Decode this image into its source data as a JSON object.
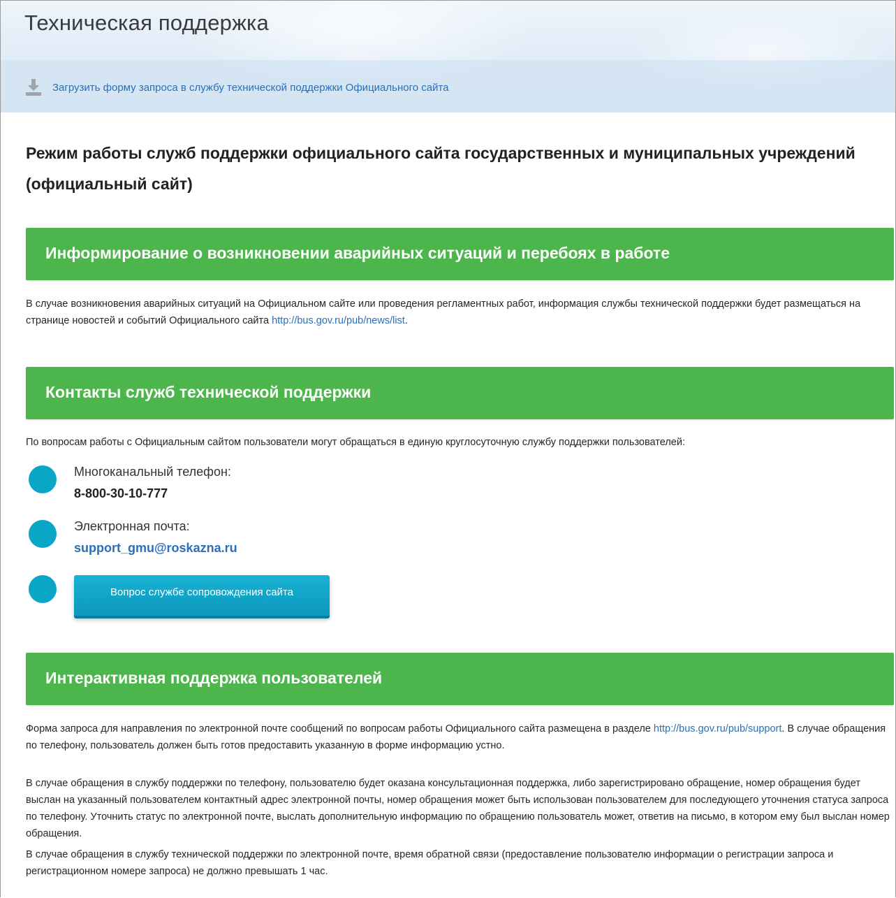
{
  "header": {
    "title": "Техническая поддержка",
    "download_icon": "download-icon",
    "download_link": "Загрузить форму запроса в службу технической поддержки Официального сайта"
  },
  "main_heading": "Режим работы служб поддержки официального сайта государственных и муниципальных учреждений (официальный сайт)",
  "sections": {
    "incidents": {
      "title": "Информирование о возникновении аварийных ситуаций и перебоях в работе",
      "text": "В случае возникновения аварийных ситуаций на Официальном сайте или проведения регламентных работ, информация службы технической поддержки будет размещаться на странице новостей и событий Официального сайта ",
      "link": "http://bus.gov.ru/pub/news/list",
      "text_end": "."
    },
    "contacts": {
      "title": "Контакты служб технической поддержки",
      "intro": "По вопросам работы с Официальным сайтом пользователи могут обращаться в единую круглосуточную службу поддержки пользователей:",
      "phone_label": "Многоканальный телефон:",
      "phone_value": "8-800-30-10-777",
      "email_label": "Электронная почта:",
      "email_value": "support_gmu@roskazna.ru",
      "button_label": "Вопрос службе сопровождения сайта"
    },
    "interactive": {
      "title": "Интерактивная поддержка пользователей",
      "p1_start": "Форма запроса для направления по электронной почте сообщений по вопросам работы Официального сайта размещена в разделе ",
      "p1_link": "http://bus.gov.ru/pub/support",
      "p1_end": ". В случае обращения по телефону, пользователь должен быть готов предоставить указанную в форме информацию устно.",
      "p2": "В случае обращения в службу поддержки по телефону, пользователю будет оказана консультационная поддержка, либо зарегистрировано обращение, номер обращения будет выслан на указанный пользователем контактный адрес электронной почты, номер обращения может быть использован пользователем для последующего уточнения статуса запроса по телефону. Уточнить статус по электронной почте, выслать дополнительную информацию по обращению пользователь может, ответив на письмо, в котором ему был выслан номер обращения.",
      "p3": "В случае обращения в службу технической поддержки по электронной почте, время обратной связи (предоставление пользователю информации о регистрации запроса и регистрационном номере запроса) не должно превышать 1 час."
    }
  },
  "colors": {
    "accent_green": "#4cb54c",
    "accent_blue": "#0aa6c8",
    "link": "#2a6fb8"
  }
}
